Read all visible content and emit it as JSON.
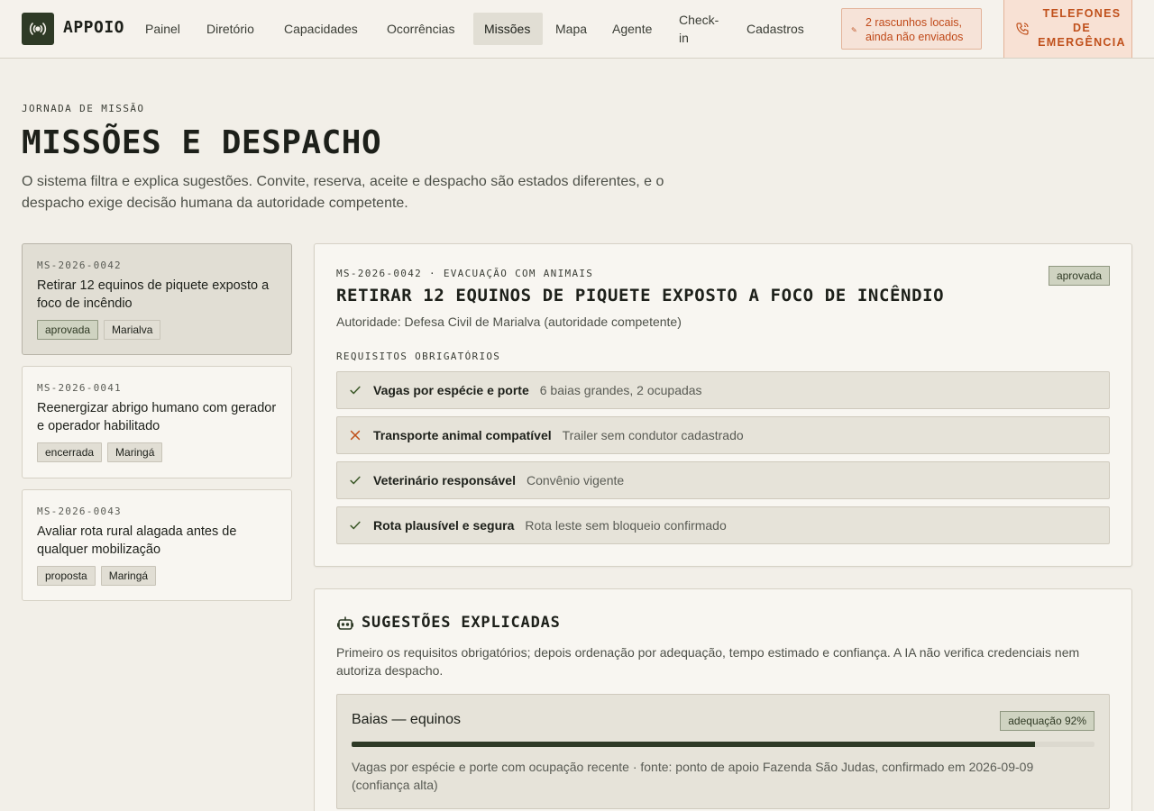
{
  "app": {
    "name": "APPOIO"
  },
  "nav": [
    {
      "label": "Painel"
    },
    {
      "label": "Diretório"
    },
    {
      "label": "Capacidades"
    },
    {
      "label": "Ocorrências"
    },
    {
      "label": "Missões",
      "active": true
    },
    {
      "label": "Mapa"
    },
    {
      "label": "Agente"
    },
    {
      "label": "Check-in"
    },
    {
      "label": "Cadastros"
    }
  ],
  "drafts": {
    "text": "2 rascunhos locais, ainda não enviados"
  },
  "emergency": {
    "label": "TELEFONES DE EMERGÊNCIA"
  },
  "hero": {
    "eyebrow": "JORNADA DE MISSÃO",
    "title": "MISSÕES E DESPACHO",
    "lede": "O sistema filtra e explica sugestões. Convite, reserva, aceite e despacho são estados diferentes, e o despacho exige decisão humana da autoridade competente."
  },
  "missions": [
    {
      "code": "MS-2026-0042",
      "title": "Retirar 12 equinos de piquete exposto a foco de incêndio",
      "status": "aprovada",
      "city": "Marialva",
      "selected": true
    },
    {
      "code": "MS-2026-0041",
      "title": "Reenergizar abrigo humano com gerador e operador habilitado",
      "status": "encerrada",
      "city": "Maringá"
    },
    {
      "code": "MS-2026-0043",
      "title": "Avaliar rota rural alagada antes de qualquer mobilização",
      "status": "proposta",
      "city": "Maringá"
    }
  ],
  "detail": {
    "code_line": "MS-2026-0042 · EVACUAÇÃO COM ANIMAIS",
    "status": "aprovada",
    "title": "RETIRAR 12 EQUINOS DE PIQUETE EXPOSTO A FOCO DE INCÊNDIO",
    "authority": "Autoridade: Defesa Civil de Marialva (autoridade competente)",
    "requirements_heading": "REQUISITOS OBRIGATÓRIOS",
    "requirements": [
      {
        "label": "Vagas por espécie e porte",
        "value": "6 baias grandes, 2 ocupadas",
        "ok": true
      },
      {
        "label": "Transporte animal compatível",
        "value": "Trailer sem condutor cadastrado",
        "ok": false
      },
      {
        "label": "Veterinário responsável",
        "value": "Convênio vigente",
        "ok": true
      },
      {
        "label": "Rota plausível e segura",
        "value": "Rota leste sem bloqueio confirmado",
        "ok": true
      }
    ]
  },
  "suggestions": {
    "title": "SUGESTÕES EXPLICADAS",
    "description": "Primeiro os requisitos obrigatórios; depois ordenação por adequação, tempo estimado e confiança. A IA não verifica credenciais nem autoriza despacho.",
    "items": [
      {
        "name": "Baias — equinos",
        "score_label": "adequação 92%",
        "score": 92,
        "detail": "Vagas por espécie e porte com ocupação recente · fonte: ponto de apoio Fazenda São Judas, confirmado em 2026-09-09 (confiança alta)"
      }
    ]
  },
  "colors": {
    "accent": "#2e3a26",
    "warning": "#c04a1a",
    "ok": "#3d5a2a",
    "fail": "#c0501b"
  }
}
